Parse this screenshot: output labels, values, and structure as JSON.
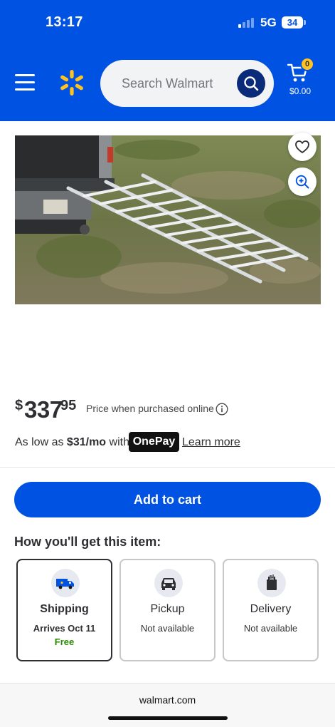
{
  "status_bar": {
    "time": "13:17",
    "network": "5G",
    "battery": "34"
  },
  "header": {
    "search_placeholder": "Search Walmart",
    "cart_count": "0",
    "cart_total": "$0.00",
    "brand_color": "#0053e2",
    "icons": [
      "menu-icon",
      "walmart-spark-icon",
      "search-icon",
      "cart-icon"
    ]
  },
  "product": {
    "image_icons": [
      "heart-icon",
      "zoom-in-icon"
    ],
    "price": {
      "currency": "$",
      "dollars": "337",
      "cents": "95",
      "note": "Price when purchased online"
    },
    "financing": {
      "prefix": "As low as ",
      "amount": "$31/mo",
      "suffix": " with",
      "badge": "OnePay",
      "link": "Learn more"
    }
  },
  "actions": {
    "add_to_cart": "Add to cart",
    "button_color": "#0053e2"
  },
  "fulfillment": {
    "title": "How you'll get this item:",
    "options": [
      {
        "label": "Shipping",
        "status": "Arrives Oct 11",
        "price": "Free",
        "icon": "truck-icon",
        "selected": true
      },
      {
        "label": "Pickup",
        "status": "Not available",
        "icon": "car-icon",
        "selected": false
      },
      {
        "label": "Delivery",
        "status": "Not available",
        "icon": "bag-icon",
        "selected": false
      }
    ],
    "free_color": "#2a8703"
  },
  "browser": {
    "domain": "walmart.com"
  }
}
